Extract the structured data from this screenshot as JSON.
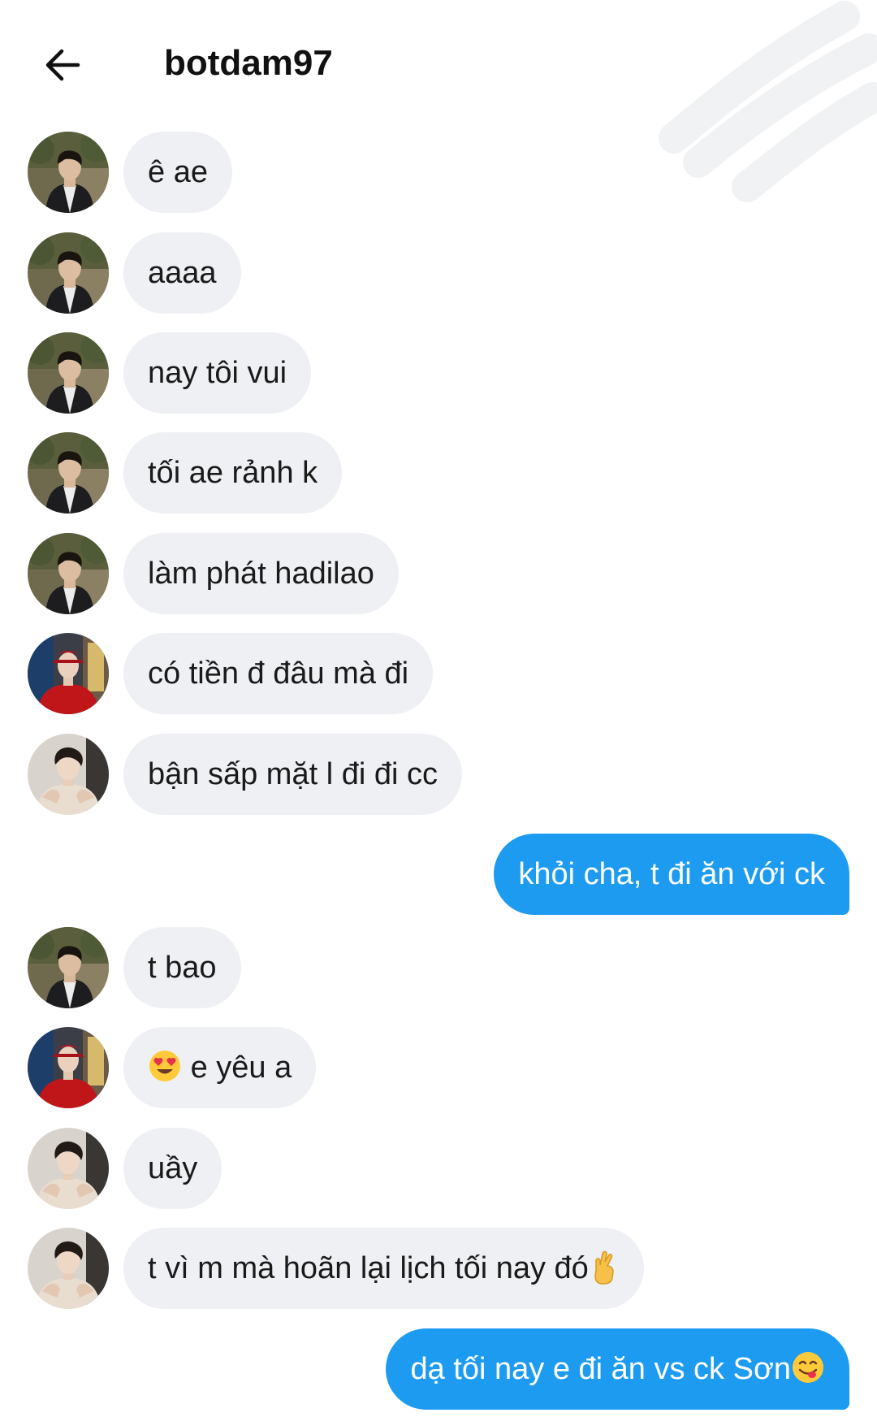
{
  "header": {
    "title": "botdam97",
    "back_icon": "arrow-left-icon"
  },
  "colors": {
    "incoming_bubble": "#eef0f4",
    "outgoing_bubble": "#1d9bf0",
    "incoming_text": "#1a1a1a",
    "outgoing_text": "#ffffff"
  },
  "messages": [
    {
      "sender": "a",
      "text": "ê ae"
    },
    {
      "sender": "a",
      "text": "aaaa"
    },
    {
      "sender": "a",
      "text": "nay tôi vui"
    },
    {
      "sender": "a",
      "text": "tối ae rảnh k"
    },
    {
      "sender": "a",
      "text": "làm phát hadilao"
    },
    {
      "sender": "b",
      "text": "có tiền đ đâu mà đi"
    },
    {
      "sender": "c",
      "text": "bận sấp mặt l đi đi cc"
    },
    {
      "sender": "me",
      "text": "khỏi cha, t đi ăn với ck"
    },
    {
      "sender": "a",
      "text": "t bao"
    },
    {
      "sender": "b",
      "text": "e yêu a",
      "emoji_before": "heart-eyes-emoji"
    },
    {
      "sender": "c",
      "text": "uầy"
    },
    {
      "sender": "c",
      "text": "t vì m mà hoãn lại lịch tối nay đó",
      "emoji_after": "crossed-fingers-emoji"
    },
    {
      "sender": "me",
      "text": "dạ tối nay e đi ăn vs ck Sơn",
      "emoji_after": "yum-face-emoji"
    }
  ]
}
